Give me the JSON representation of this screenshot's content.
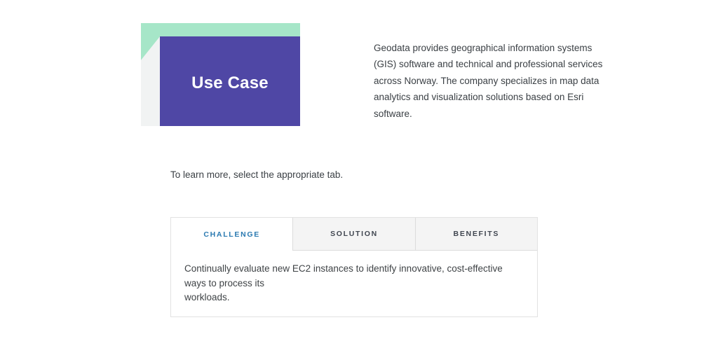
{
  "hero": {
    "image_label": "Use Case",
    "colors": {
      "mint": "#a6e6c8",
      "purple": "#4f47a5",
      "fold_gray": "#f1f3f3",
      "label_text": "#ffffff"
    },
    "description_lines": [
      "Geodata provides geographical information systems",
      "(GIS) software and technical and professional services",
      "across Norway. The company specializes in map data",
      "analytics and visualization solutions based on Esri",
      "software."
    ]
  },
  "instruction": "To learn more, select the appropriate tab.",
  "tabs": {
    "items": [
      {
        "label": "CHALLENGE",
        "active": true
      },
      {
        "label": "SOLUTION",
        "active": false
      },
      {
        "label": "BENEFITS",
        "active": false
      }
    ],
    "colors": {
      "active_text": "#2b7ab1",
      "inactive_text": "#404650",
      "inactive_bg": "#f4f4f4",
      "border": "#dcdcdc"
    },
    "active_panel_lines": [
      "Continually evaluate new EC2 instances to identify innovative, cost-effective ways to process its",
      "workloads."
    ]
  }
}
